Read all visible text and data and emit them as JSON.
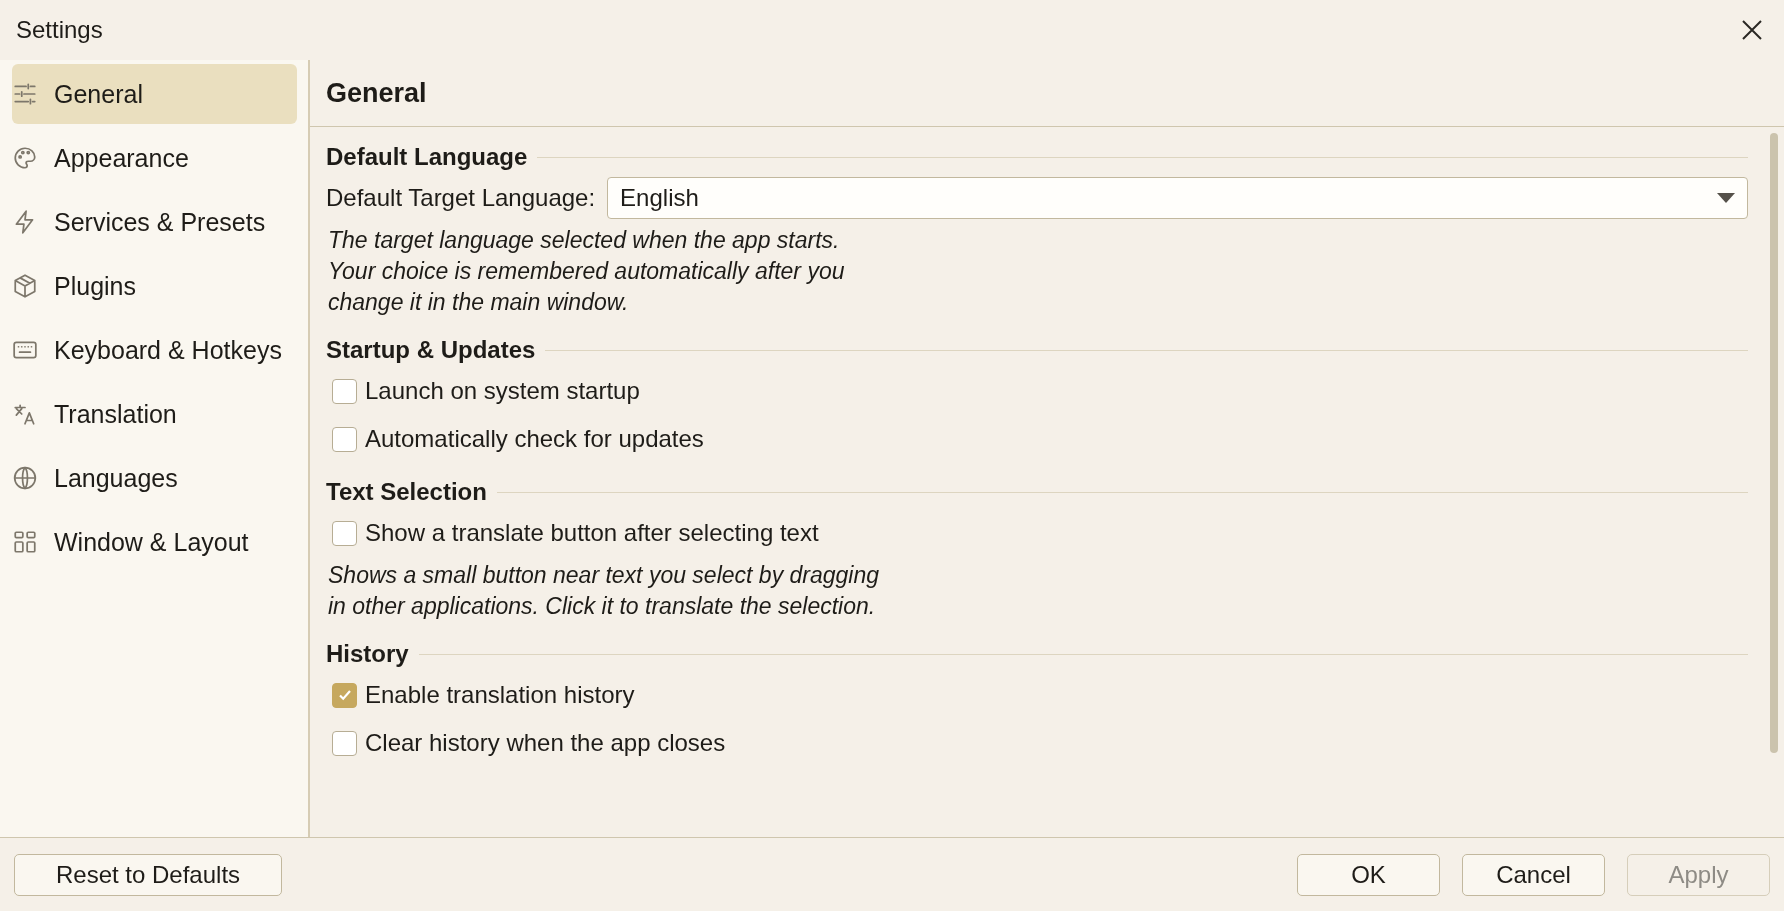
{
  "window": {
    "title": "Settings"
  },
  "sidebar": {
    "items": [
      {
        "label": "General",
        "selected": true
      },
      {
        "label": "Appearance",
        "selected": false
      },
      {
        "label": "Services & Presets",
        "selected": false
      },
      {
        "label": "Plugins",
        "selected": false
      },
      {
        "label": "Keyboard & Hotkeys",
        "selected": false
      },
      {
        "label": "Translation",
        "selected": false
      },
      {
        "label": "Languages",
        "selected": false
      },
      {
        "label": "Window & Layout",
        "selected": false
      }
    ]
  },
  "page": {
    "title": "General",
    "sections": [
      {
        "heading": "Default Language",
        "items": [
          {
            "kind": "select",
            "label": "Default Target Language:",
            "value": "English"
          },
          {
            "kind": "note",
            "text": "The target language selected when the app starts. Your choice is remembered automatically after you change it in the main window."
          }
        ]
      },
      {
        "heading": "Startup & Updates",
        "items": [
          {
            "kind": "checkbox",
            "label": "Launch on system startup",
            "checked": false
          },
          {
            "kind": "checkbox",
            "label": "Automatically check for updates",
            "checked": false
          }
        ]
      },
      {
        "heading": "Text Selection",
        "items": [
          {
            "kind": "checkbox",
            "label": "Show a translate button after selecting text",
            "checked": false
          },
          {
            "kind": "note",
            "text": "Shows a small button near text you select by dragging in other applications. Click it to translate the selection."
          }
        ]
      },
      {
        "heading": "History",
        "items": [
          {
            "kind": "checkbox",
            "label": "Enable translation history",
            "checked": true
          },
          {
            "kind": "checkbox",
            "label": "Clear history when the app closes",
            "checked": false
          }
        ]
      }
    ]
  },
  "footer": {
    "reset_button": "Reset to Defaults",
    "buttons": [
      {
        "label": "OK",
        "disabled": false
      },
      {
        "label": "Cancel",
        "disabled": false
      },
      {
        "label": "Apply",
        "disabled": true
      }
    ]
  }
}
